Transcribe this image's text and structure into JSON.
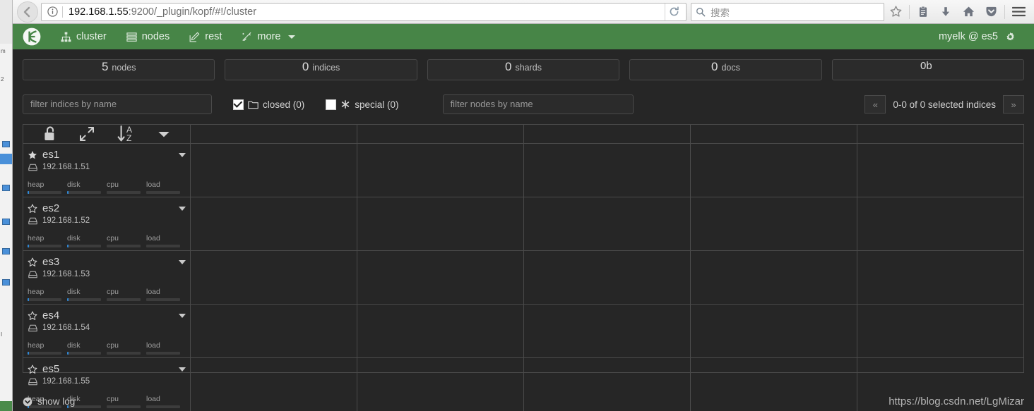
{
  "browser": {
    "back_icon": "back-arrow-icon",
    "identity_icon": "info-icon",
    "url_host": "192.168.1.55",
    "url_rest": ":9200/_plugin/kopf/#!/cluster",
    "reload_icon": "reload-icon",
    "search_placeholder": "搜索",
    "search_icon": "search-icon",
    "toolbar_icons": [
      "bookmark-star-icon",
      "library-icon",
      "downloads-icon",
      "home-icon",
      "pocket-icon",
      "menu-icon"
    ]
  },
  "navbar": {
    "brand": "kopf-logo",
    "links": [
      {
        "label": "cluster",
        "icon": "sitemap-icon"
      },
      {
        "label": "nodes",
        "icon": "list-icon"
      },
      {
        "label": "rest",
        "icon": "edit-icon"
      },
      {
        "label": "more",
        "icon": "magic-wand-icon",
        "caret": true
      }
    ],
    "cluster_user": "myelk @ es5",
    "settings_icon": "gear-icon"
  },
  "stats": [
    {
      "num": "5",
      "label": "nodes"
    },
    {
      "num": "0",
      "label": "indices"
    },
    {
      "num": "0",
      "label": "shards"
    },
    {
      "num": "0",
      "label": "docs"
    },
    {
      "num": "0b",
      "label": ""
    }
  ],
  "filters": {
    "indices_placeholder": "filter indices by name",
    "indices_value": "",
    "nodes_placeholder": "filter nodes by name",
    "nodes_value": "",
    "closed_label": "closed (0)",
    "closed_checked": true,
    "closed_icon": "folder-icon",
    "special_label": "special (0)",
    "special_checked": false,
    "special_icon": "asterisk-icon",
    "pager_prev": "«",
    "pager_next": "»",
    "pager_text": "0-0 of 0 selected indices"
  },
  "grid_header": {
    "tools": [
      {
        "icon": "unlock-icon",
        "name": "toggle-lock-button"
      },
      {
        "icon": "expand-arrows-icon",
        "name": "expand-button"
      },
      {
        "icon": "sort-alpha-icon",
        "name": "sort-button"
      },
      {
        "icon": "caret-down-icon",
        "name": "options-caret"
      }
    ]
  },
  "nodes": [
    {
      "name": "es1",
      "ip": "192.168.1.51",
      "master": true,
      "star_icon": "star-filled-icon",
      "hdd_icon": "hdd-icon",
      "caret_icon": "caret-down-icon",
      "metrics": [
        {
          "label": "heap",
          "pct": 5
        },
        {
          "label": "disk",
          "pct": 5
        },
        {
          "label": "cpu",
          "pct": 0
        },
        {
          "label": "load",
          "pct": 0
        }
      ]
    },
    {
      "name": "es2",
      "ip": "192.168.1.52",
      "master": false,
      "star_icon": "star-outline-icon",
      "hdd_icon": "hdd-icon",
      "caret_icon": "caret-down-icon",
      "metrics": [
        {
          "label": "heap",
          "pct": 5
        },
        {
          "label": "disk",
          "pct": 5
        },
        {
          "label": "cpu",
          "pct": 0
        },
        {
          "label": "load",
          "pct": 0
        }
      ]
    },
    {
      "name": "es3",
      "ip": "192.168.1.53",
      "master": false,
      "star_icon": "star-outline-icon",
      "hdd_icon": "hdd-icon",
      "caret_icon": "caret-down-icon",
      "metrics": [
        {
          "label": "heap",
          "pct": 5
        },
        {
          "label": "disk",
          "pct": 5
        },
        {
          "label": "cpu",
          "pct": 0
        },
        {
          "label": "load",
          "pct": 0
        }
      ]
    },
    {
      "name": "es4",
      "ip": "192.168.1.54",
      "master": false,
      "star_icon": "star-outline-icon",
      "hdd_icon": "hdd-icon",
      "caret_icon": "caret-down-icon",
      "metrics": [
        {
          "label": "heap",
          "pct": 5
        },
        {
          "label": "disk",
          "pct": 5
        },
        {
          "label": "cpu",
          "pct": 0
        },
        {
          "label": "load",
          "pct": 0
        }
      ]
    },
    {
      "name": "es5",
      "ip": "192.168.1.55",
      "master": false,
      "star_icon": "star-outline-icon",
      "hdd_icon": "hdd-icon",
      "caret_icon": "caret-down-icon",
      "metrics": [
        {
          "label": "heap",
          "pct": 5
        },
        {
          "label": "disk",
          "pct": 5
        },
        {
          "label": "cpu",
          "pct": 0
        },
        {
          "label": "load",
          "pct": 0
        }
      ]
    }
  ],
  "footer": {
    "show_log": "show log",
    "show_log_icon": "chevron-circle-down-icon",
    "watermark": "https://blog.csdn.net/LgMizar"
  },
  "colors": {
    "navbar_green": "#478547",
    "body_bg": "#262626",
    "accent_blue": "#2f88d6",
    "border": "#4a4a4a"
  }
}
